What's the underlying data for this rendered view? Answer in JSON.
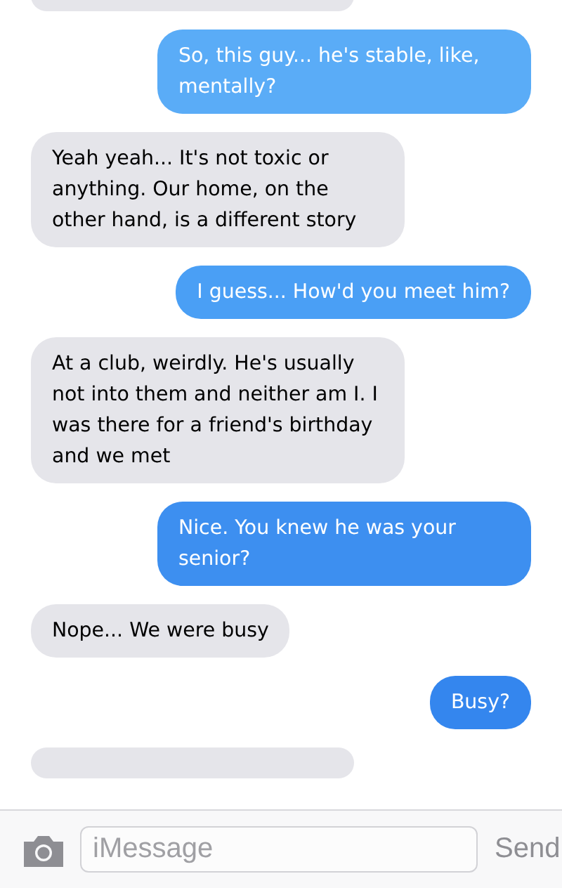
{
  "messages": [
    {
      "kind": "cut",
      "color": "#e5e5ea"
    },
    {
      "kind": "sent",
      "text": "So, this guy... he's stable, like, mentally?",
      "color": "#5aacf7"
    },
    {
      "kind": "received",
      "text": "Yeah yeah... It's not toxic or anything. Our home, on the other hand, is a different story",
      "color": "#e5e5ea"
    },
    {
      "kind": "sent",
      "text": "I guess... How'd you meet him?",
      "color": "#4a9ff5"
    },
    {
      "kind": "received",
      "text": "At a club, weirdly. He's usually not into them and neither am I. I was there for a friend's birthday and we met",
      "color": "#e5e5ea"
    },
    {
      "kind": "sent",
      "text": "Nice. You knew he was your senior?",
      "color": "#3d8ff0"
    },
    {
      "kind": "received",
      "text": "Nope... We were busy",
      "color": "#e5e5ea"
    },
    {
      "kind": "sent",
      "text": "Busy?",
      "color": "#3486ee"
    },
    {
      "kind": "cut",
      "color": "#e5e5ea"
    }
  ],
  "composer": {
    "placeholder": "iMessage",
    "send": "Send"
  }
}
